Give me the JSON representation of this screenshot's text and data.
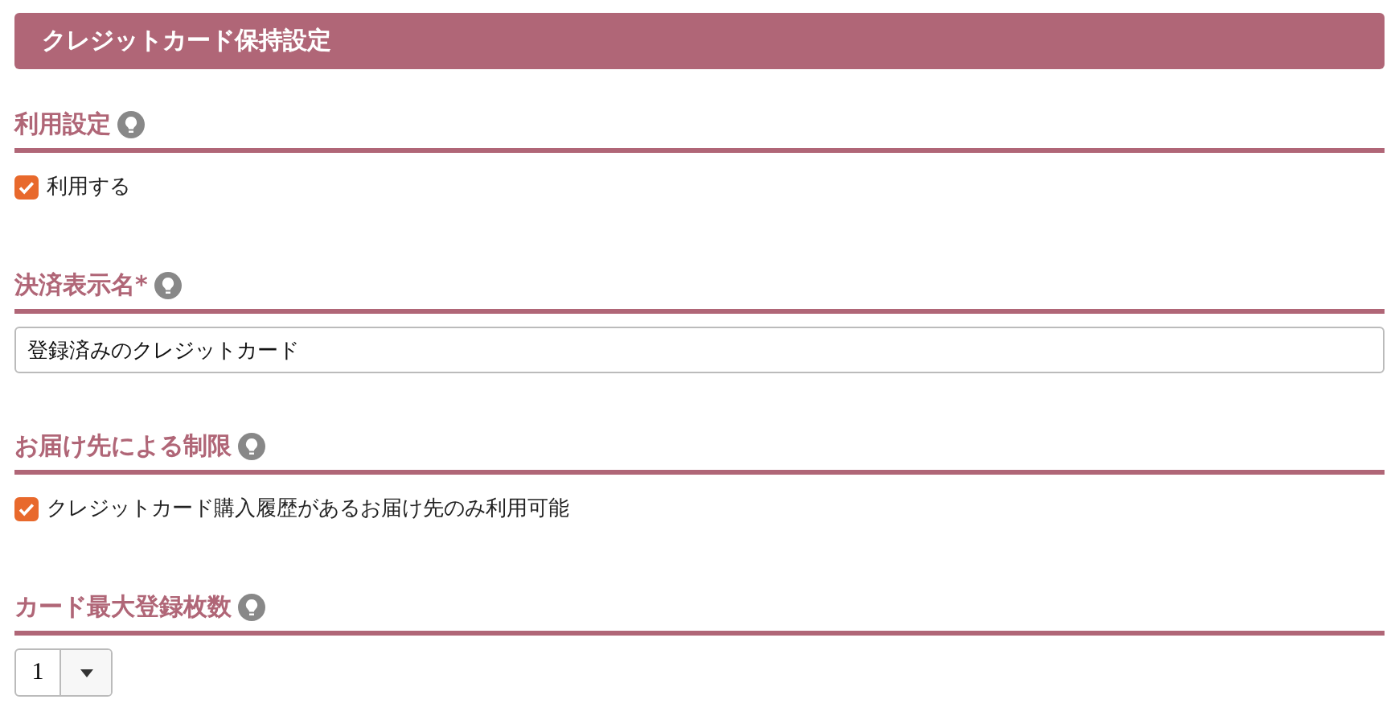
{
  "header": {
    "title": "クレジットカード保持設定"
  },
  "sections": [
    {
      "title": "利用設定",
      "kind": "checkbox",
      "label": "利用する",
      "checked": true
    },
    {
      "title": "決済表示名*",
      "kind": "text",
      "value": "登録済みのクレジットカード"
    },
    {
      "title": "お届け先による制限",
      "kind": "checkbox",
      "label": "クレジットカード購入履歴があるお届け先のみ利用可能",
      "checked": true
    },
    {
      "title": "カード最大登録枚数",
      "kind": "select",
      "value": "1"
    }
  ]
}
